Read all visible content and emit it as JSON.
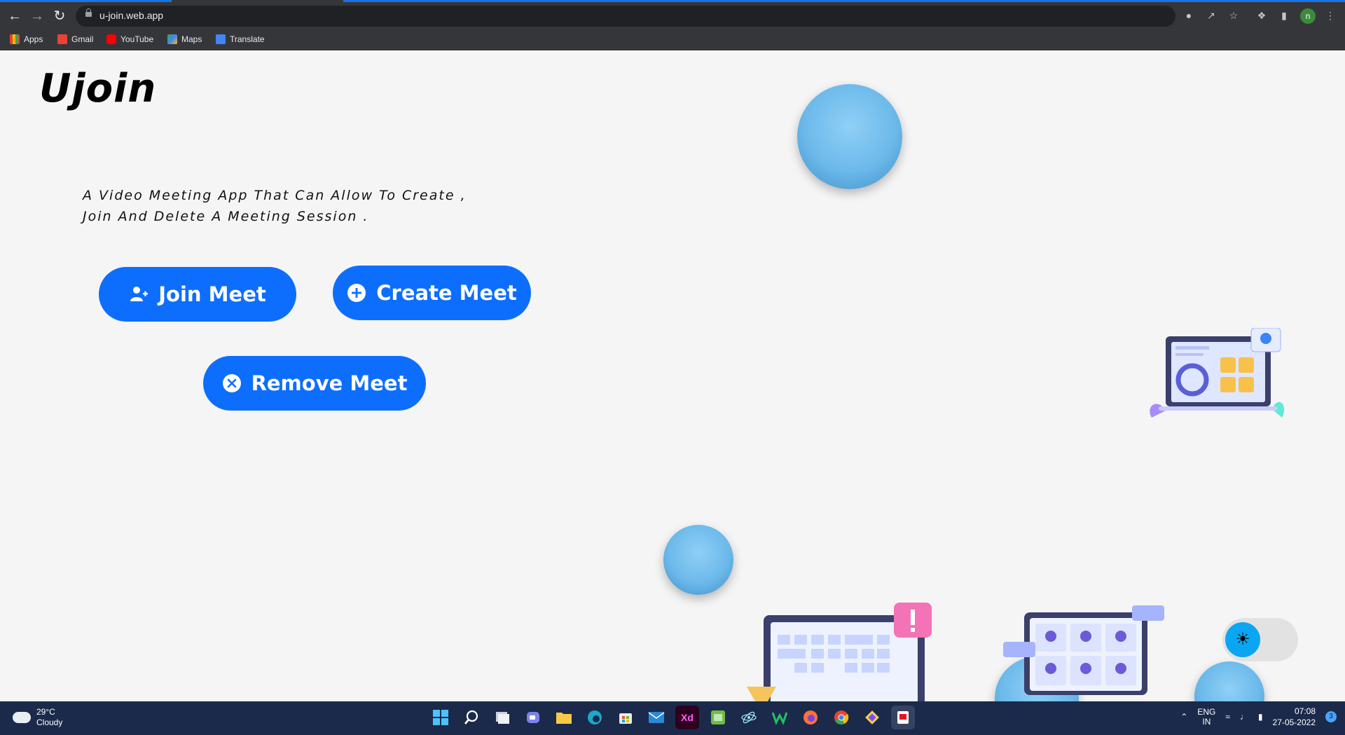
{
  "browser": {
    "url": "u-join.web.app",
    "bookmarks": [
      "Apps",
      "Gmail",
      "YouTube",
      "Maps",
      "Translate"
    ],
    "profile_initial": "n"
  },
  "page": {
    "logo": "Ujoin",
    "tagline_line1": "A Video Meeting App That Can Allow To Create ,",
    "tagline_line2": "Join And Delete A Meeting Session .",
    "buttons": {
      "join": "Join Meet",
      "create": "Create Meet",
      "remove": "Remove Meet"
    },
    "theme_toggle_icon": "sun-icon",
    "accent_color": "#0d6efd"
  },
  "taskbar": {
    "weather_temp": "29°C",
    "weather_desc": "Cloudy",
    "lang_top": "ENG",
    "lang_bottom": "IN",
    "time": "07:08",
    "date": "27-05-2022",
    "notification_count": "3",
    "apps": [
      "start-icon",
      "search-icon",
      "task-view-icon",
      "teams-icon",
      "file-explorer-icon",
      "edge-icon",
      "store-icon",
      "mail-icon",
      "xd-icon",
      "app-icon",
      "electron-icon",
      "w-app-icon",
      "firefox-icon",
      "chrome-icon",
      "git-icon",
      "snipping-icon"
    ],
    "xd_label": "Xd"
  }
}
